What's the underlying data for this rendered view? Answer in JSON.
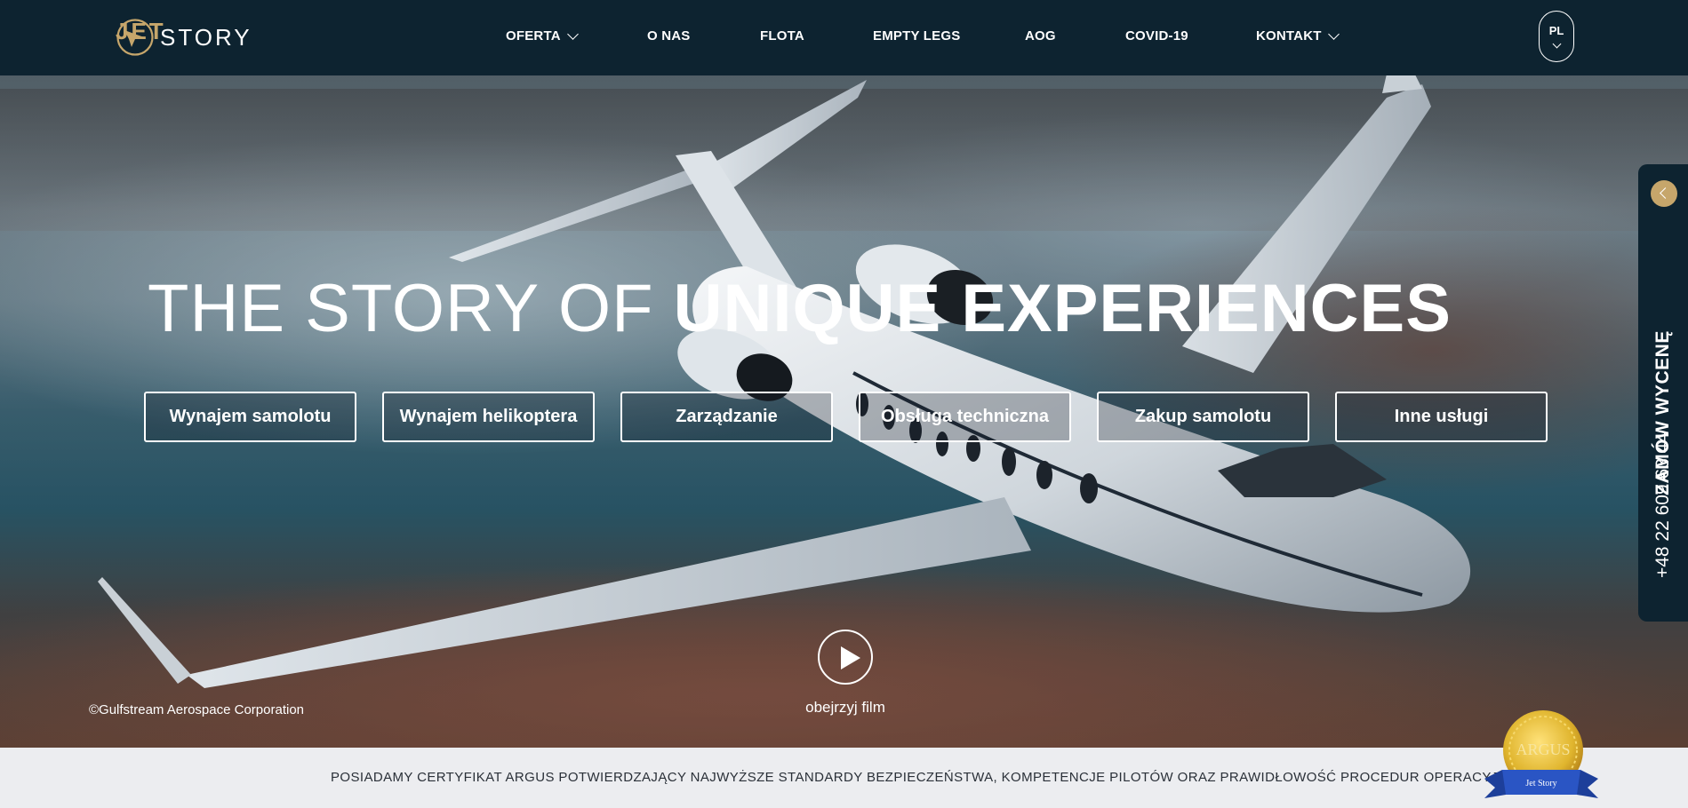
{
  "brand": {
    "logo_part1": "JET",
    "logo_part2": "STORY"
  },
  "nav": {
    "items": [
      {
        "label": "OFERTA",
        "has_dropdown": true
      },
      {
        "label": "O NAS",
        "has_dropdown": false
      },
      {
        "label": "FLOTA",
        "has_dropdown": false
      },
      {
        "label": "EMPTY LEGS",
        "has_dropdown": false
      },
      {
        "label": "AOG",
        "has_dropdown": false
      },
      {
        "label": "COVID-19",
        "has_dropdown": false
      },
      {
        "label": "KONTAKT",
        "has_dropdown": true
      }
    ],
    "language": "PL"
  },
  "hero": {
    "headline_light": "THE STORY OF ",
    "headline_bold": "UNIQUE EXPERIENCES",
    "services": [
      "Wynajem samolotu",
      "Wynajem helikoptera",
      "Zarządzanie",
      "Obsługa techniczna",
      "Zakup samolotu",
      "Inne usługi"
    ],
    "video_label": "obejrzyj film",
    "credit": "©Gulfstream Aerospace Corporation"
  },
  "sidetab": {
    "quote_label": "ZAMÓW WYCENĘ",
    "phone": "+48 22 609 63 44"
  },
  "certbar": {
    "text": "POSIADAMY CERTYFIKAT ARGUS POTWIERDZAJĄCY NAJWYŻSZE STANDARDY BEZPIECZEŃSTWA, KOMPETENCJE PILOTÓW ORAZ PRAWIDŁOWOŚĆ PROCEDUR OPERACYJNYCH",
    "badge_name": "ARGUS",
    "badge_ribbon": "Jet Story"
  },
  "colors": {
    "header_bg": "#0d2330",
    "accent_gold": "#c6a66b",
    "certbar_bg": "#ecedf0"
  }
}
